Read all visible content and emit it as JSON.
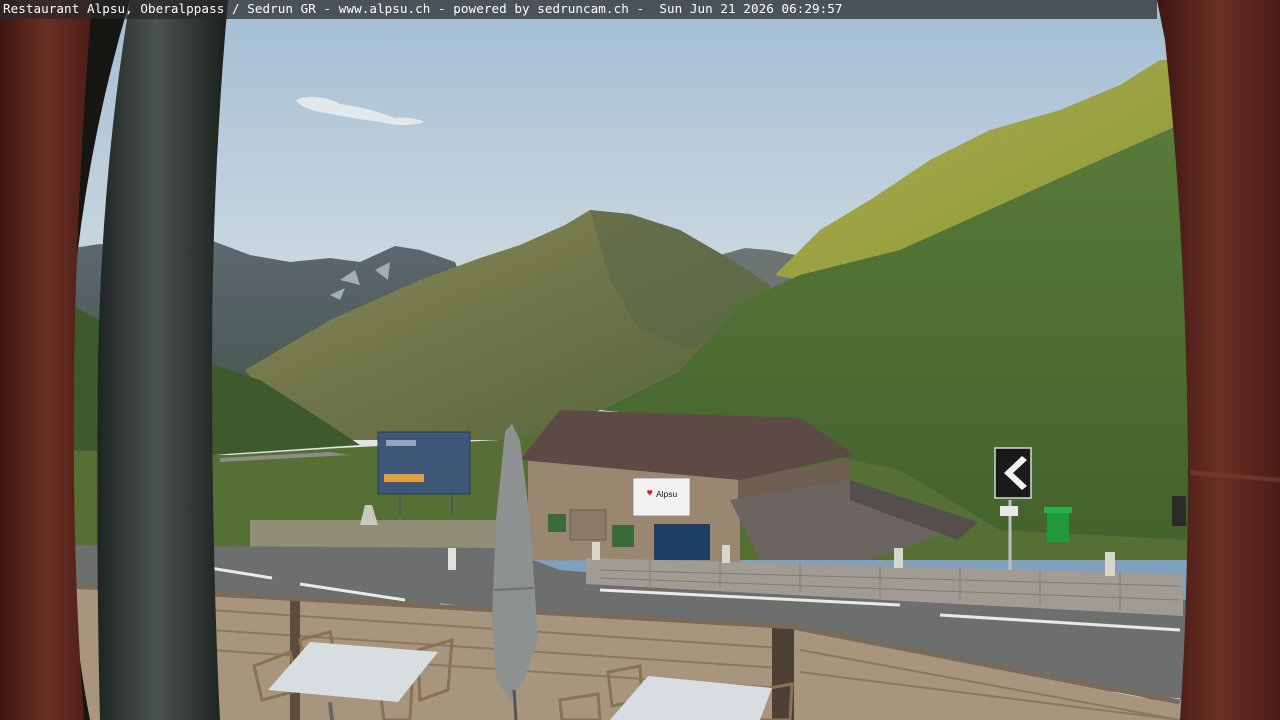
{
  "overlay": {
    "caption": "Restaurant Alpsu, Oberalppass / Sedrun GR - www.alpsu.ch - powered by sedruncam.ch -  Sun Jun 21 2026 06:29:57"
  },
  "hut_sign": {
    "text": "Alpsu"
  },
  "colors": {
    "sky_top": "#a7c0d6",
    "sky_bottom": "#dfe6e6",
    "sunlit_slope": "#9aa040",
    "shaded_slope": "#4e6b35",
    "window_frame": "#5e2a22"
  }
}
